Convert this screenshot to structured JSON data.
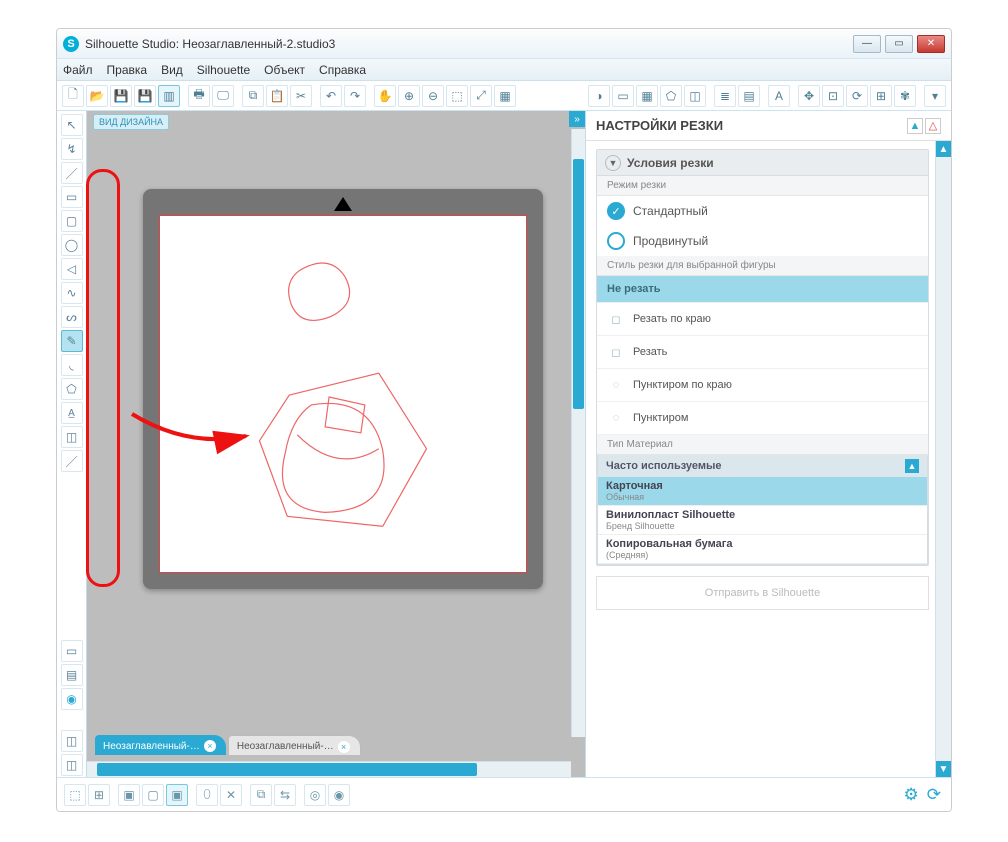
{
  "window": {
    "title": "Silhouette Studio: Неозаглавленный-2.studio3"
  },
  "menu": [
    "Файл",
    "Правка",
    "Вид",
    "Silhouette",
    "Объект",
    "Справка"
  ],
  "design_tag": "ВИД ДИЗАЙНА",
  "tabs": [
    {
      "label": "Неозаглавленный-…",
      "active": true
    },
    {
      "label": "Неозаглавленный-…",
      "active": false
    }
  ],
  "right": {
    "title": "НАСТРОЙКИ РЕЗКИ",
    "section": "Условия резки",
    "mode_label": "Режим резки",
    "modes": [
      {
        "label": "Стандартный",
        "checked": true
      },
      {
        "label": "Продвинутый",
        "checked": false
      }
    ],
    "style_label": "Стиль резки для выбранной фигуры",
    "styles": [
      "Не резать",
      "Резать по краю",
      "Резать",
      "Пунктиром по краю",
      "Пунктиром"
    ],
    "material_label": "Тип Материал",
    "material_head": "Часто используемые",
    "materials": [
      {
        "title": "Карточная",
        "sub": "Обычная",
        "sel": true
      },
      {
        "title": "Винилопласт Silhouette",
        "sub": "Бренд Silhouette"
      },
      {
        "title": "Копировальная бумага",
        "sub": "(Средняя)"
      }
    ],
    "send": "Отправить в Silhouette"
  }
}
